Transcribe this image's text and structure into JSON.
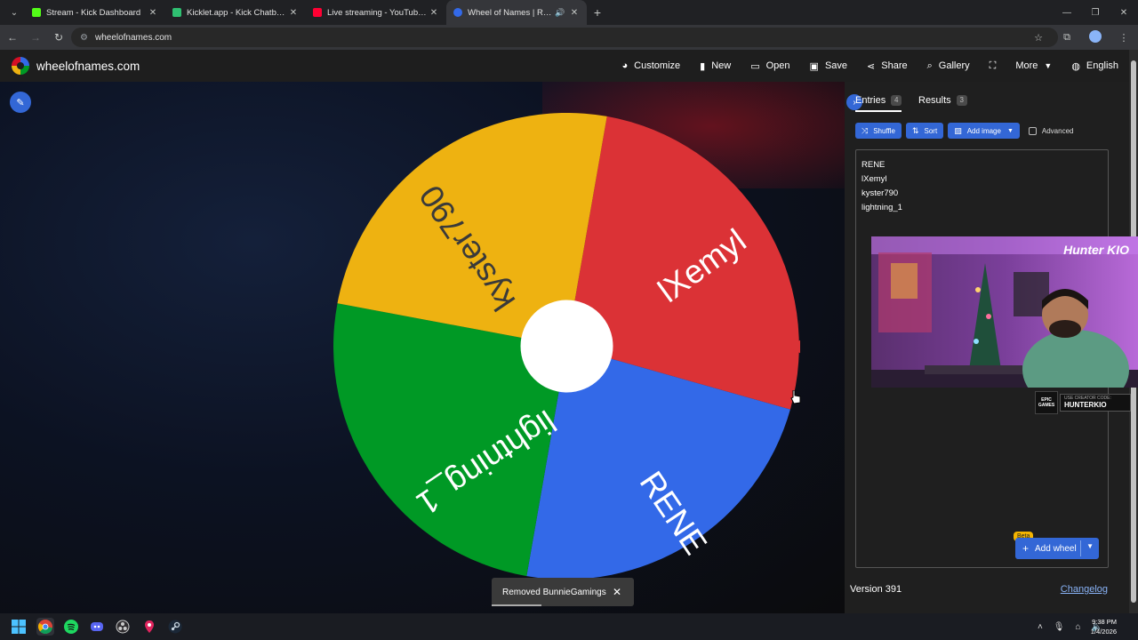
{
  "browser": {
    "tabs": [
      {
        "title": "Stream - Kick Dashboard",
        "favicon_color": "#53fc18",
        "active": false
      },
      {
        "title": "Kicklet.app - Kick Chatbot and",
        "favicon_color": "#2fbf71",
        "active": false
      },
      {
        "title": "Live streaming - YouTube Studio",
        "favicon_color": "#ff0033",
        "active": false
      },
      {
        "title": "Wheel of Names | Random",
        "favicon_color": "#3369e8",
        "active": true
      }
    ],
    "url": "wheelofnames.com"
  },
  "site": {
    "name": "wheelofnames.com",
    "menu": [
      {
        "label": "Customize",
        "icon": "palette-icon"
      },
      {
        "label": "New",
        "icon": "file-icon"
      },
      {
        "label": "Open",
        "icon": "folder-icon"
      },
      {
        "label": "Save",
        "icon": "save-icon"
      },
      {
        "label": "Share",
        "icon": "share-icon"
      },
      {
        "label": "Gallery",
        "icon": "search-icon"
      },
      {
        "label": "",
        "icon": "fullscreen-icon"
      },
      {
        "label": "More",
        "icon": "chevron-down-icon"
      },
      {
        "label": "English",
        "icon": "globe-icon"
      }
    ]
  },
  "wheel": {
    "segments": [
      {
        "label": "lXemyl",
        "color": "#db3236"
      },
      {
        "label": "RENE",
        "color": "#3369e8"
      },
      {
        "label": "lightning_1",
        "color": "#009925"
      },
      {
        "label": "kyster790",
        "color": "#eeb211"
      }
    ],
    "pointer_color": "#db3236"
  },
  "toast": {
    "message": "Removed BunnieGamings"
  },
  "panel": {
    "tabs": {
      "entries_label": "Entries",
      "entries_count": "4",
      "results_label": "Results",
      "results_count": "3"
    },
    "toolbar": {
      "shuffle": "Shuffle",
      "sort": "Sort",
      "add_image": "Add image",
      "advanced": "Advanced"
    },
    "entries": [
      "RENE",
      "lXemyl",
      "kyster790",
      "lightning_1"
    ],
    "add_wheel": "Add wheel",
    "beta": "Beta",
    "version": "Version 391",
    "changelog": "Changelog"
  },
  "overlay": {
    "channel_logo": "Hunter KIO",
    "sponsor_brand": "EPIC GAMES",
    "creator_code_label": "USE CREATOR CODE:",
    "creator_code": "HUNTERKIO"
  },
  "taskbar": {
    "time": "9:38 PM",
    "date": "1/4/2026"
  }
}
